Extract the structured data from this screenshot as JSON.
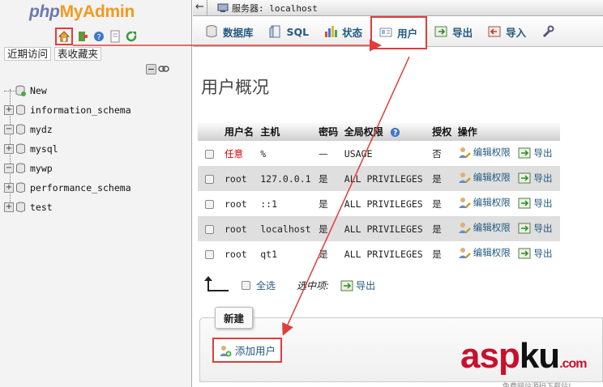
{
  "sidebar": {
    "logo": {
      "part1": "php",
      "part2": "MyAdmin"
    },
    "tabs": [
      {
        "label": "近期访问"
      },
      {
        "label": "表收藏夹"
      }
    ],
    "databases": [
      {
        "name": "New",
        "type": "new"
      },
      {
        "name": "information_schema",
        "type": "expand"
      },
      {
        "name": "mydz",
        "type": "collapse"
      },
      {
        "name": "mysql",
        "type": "expand"
      },
      {
        "name": "mywp",
        "type": "collapse"
      },
      {
        "name": "performance_schema",
        "type": "expand"
      },
      {
        "name": "test",
        "type": "expand"
      }
    ]
  },
  "top_bar": {
    "back": "←",
    "server_label": "服务器: localhost"
  },
  "tabs": [
    {
      "label": "数据库",
      "icon": "database-icon"
    },
    {
      "label": "SQL",
      "icon": "sql-icon"
    },
    {
      "label": "状态",
      "icon": "status-icon"
    },
    {
      "label": "用户",
      "icon": "users-icon",
      "active": true
    },
    {
      "label": "导出",
      "icon": "export-icon"
    },
    {
      "label": "导入",
      "icon": "import-icon"
    }
  ],
  "page_title": "用户概况",
  "table": {
    "headers": [
      "用户名",
      "主机",
      "密码",
      "全局权限",
      "授权",
      "操作"
    ],
    "rows": [
      {
        "user": "任意",
        "host": "%",
        "password": "—",
        "privileges": "USAGE",
        "grant": "否",
        "edit": "编辑权限",
        "export": "导出"
      },
      {
        "user": "root",
        "host": "127.0.0.1",
        "password": "是",
        "privileges": "ALL PRIVILEGES",
        "grant": "是",
        "edit": "编辑权限",
        "export": "导出"
      },
      {
        "user": "root",
        "host": "::1",
        "password": "是",
        "privileges": "ALL PRIVILEGES",
        "grant": "是",
        "edit": "编辑权限",
        "export": "导出"
      },
      {
        "user": "root",
        "host": "localhost",
        "password": "是",
        "privileges": "ALL PRIVILEGES",
        "grant": "是",
        "edit": "编辑权限",
        "export": "导出"
      },
      {
        "user": "root",
        "host": "qt1",
        "password": "是",
        "privileges": "ALL PRIVILEGES",
        "grant": "是",
        "edit": "编辑权限",
        "export": "导出"
      }
    ]
  },
  "bulk": {
    "select_all": "全选",
    "with_selected": "选中项:",
    "export": "导出"
  },
  "new_section": {
    "legend": "新建",
    "add_user": "添加用户"
  },
  "watermark": {
    "text1": "asp",
    "text2": "ku",
    "suffix": ".com",
    "sub": "免费网站源码下载站!"
  },
  "colors": {
    "link": "#235a81",
    "highlight": "#e03c3c",
    "logo_php": "#6c78af",
    "logo_admin": "#f29a1f"
  }
}
